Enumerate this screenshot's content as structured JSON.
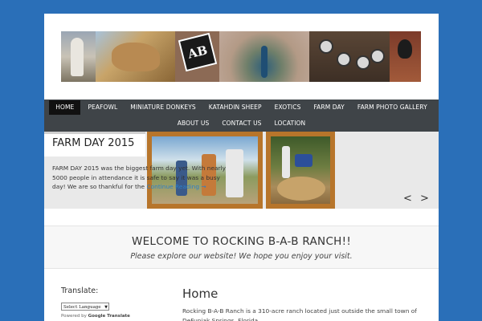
{
  "navigation": {
    "row1": [
      "HOME",
      "PEAFOWL",
      "MINIATURE DONKEYS",
      "KATAHDIN SHEEP",
      "EXOTICS",
      "FARM DAY",
      "FARM PHOTO GALLERY"
    ],
    "row2": [
      "ABOUT US",
      "CONTACT US",
      "LOCATION"
    ]
  },
  "header": {
    "logo_text": "AB"
  },
  "slider": {
    "title": "FARM DAY 2015",
    "text": "FARM DAY 2015 was the biggest farm day yet.  With nearly 5000 people in attendance it is safe to say it was a busy day! We are so thankful for the",
    "more_link": "Continue Reading →",
    "prev": "<",
    "next": ">"
  },
  "welcome": {
    "title": "WELCOME TO ROCKING B-A-B RANCH!!",
    "subtitle": "Please explore our website! We hope you enjoy your visit."
  },
  "translate": {
    "label": "Translate:",
    "select_value": "Select Language",
    "powered_by": "Powered by",
    "google_translate": "Google Translate"
  },
  "content": {
    "title": "Home",
    "text": "Rocking B-A-B Ranch is a 310-acre ranch located just outside the small town of DeFuniak Springs, Florida."
  },
  "colors": {
    "background": "#2a6fb8",
    "nav_bg": "#3f4448",
    "nav_active": "#111111",
    "link": "#2a7fc8"
  }
}
